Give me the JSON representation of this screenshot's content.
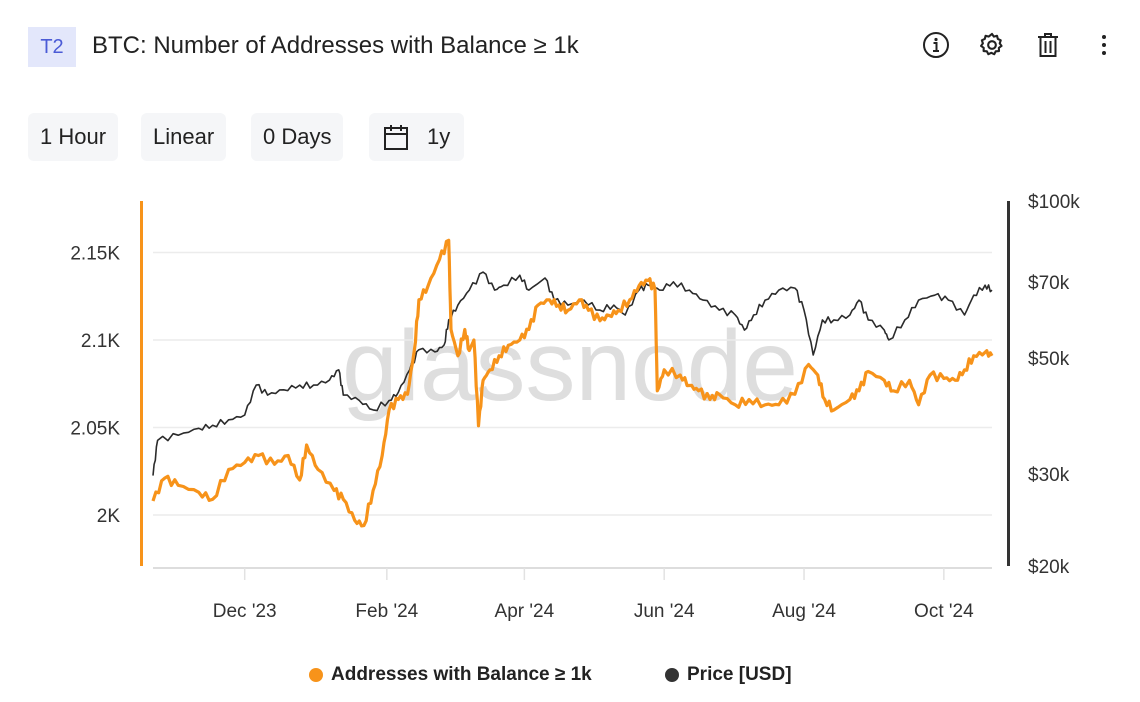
{
  "header": {
    "badge": "T2",
    "title": "BTC: Number of Addresses with Balance ≥ 1k",
    "icons": [
      "info-icon",
      "gear-icon",
      "trash-icon",
      "more-vertical-icon"
    ]
  },
  "controls": {
    "resolution": "1 Hour",
    "scale": "Linear",
    "smoothing": "0 Days",
    "range": "1y",
    "range_icon": "calendar-icon"
  },
  "chart_data": {
    "type": "line",
    "watermark": "glassnode",
    "colors": {
      "addresses": "#f7931a",
      "price": "#2b2b2b"
    },
    "x_ticks": [
      "Dec '23",
      "Feb '24",
      "Apr '24",
      "Jun '24",
      "Aug '24",
      "Oct '24"
    ],
    "x_tick_dates": [
      "2023-12-01",
      "2024-02-01",
      "2024-04-01",
      "2024-06-01",
      "2024-08-01",
      "2024-10-01"
    ],
    "xlim": [
      "2023-10-22",
      "2024-10-22"
    ],
    "y_left": {
      "ticks": [
        "2K",
        "2.05K",
        "2.1K",
        "2.15K"
      ],
      "tick_values": [
        2000,
        2050,
        2100,
        2150
      ],
      "range": [
        1970,
        2180
      ],
      "scale": "linear"
    },
    "y_right": {
      "ticks": [
        "$20k",
        "$30k",
        "$50k",
        "$70k",
        "$100k"
      ],
      "tick_values": [
        20000,
        30000,
        50000,
        70000,
        100000
      ],
      "range": [
        20000,
        100000
      ],
      "scale": "log"
    },
    "grid": true,
    "legend_position": "bottom",
    "series": [
      {
        "name": "Addresses with Balance ≥ 1k",
        "axis": "left",
        "x": [
          "2023-10-22",
          "2023-10-27",
          "2023-11-02",
          "2023-11-11",
          "2023-11-17",
          "2023-11-24",
          "2023-12-01",
          "2023-12-07",
          "2023-12-14",
          "2023-12-20",
          "2023-12-25",
          "2023-12-28",
          "2024-01-02",
          "2024-01-09",
          "2024-01-13",
          "2024-01-18",
          "2024-01-22",
          "2024-01-26",
          "2024-01-30",
          "2024-02-02",
          "2024-02-06",
          "2024-02-10",
          "2024-02-13",
          "2024-02-15",
          "2024-02-19",
          "2024-02-24",
          "2024-02-28",
          "2024-02-29",
          "2024-03-03",
          "2024-03-06",
          "2024-03-08",
          "2024-03-10",
          "2024-03-12",
          "2024-03-14",
          "2024-03-17",
          "2024-03-21",
          "2024-03-25",
          "2024-03-30",
          "2024-04-03",
          "2024-04-07",
          "2024-04-12",
          "2024-04-16",
          "2024-04-20",
          "2024-04-25",
          "2024-04-29",
          "2024-05-04",
          "2024-05-08",
          "2024-05-12",
          "2024-05-17",
          "2024-05-21",
          "2024-05-25",
          "2024-05-28",
          "2024-05-29",
          "2024-06-01",
          "2024-06-08",
          "2024-06-12",
          "2024-06-16",
          "2024-06-21",
          "2024-06-25",
          "2024-07-02",
          "2024-07-08",
          "2024-07-15",
          "2024-07-21",
          "2024-07-28",
          "2024-08-03",
          "2024-08-07",
          "2024-08-10",
          "2024-08-14",
          "2024-08-21",
          "2024-08-25",
          "2024-08-29",
          "2024-09-05",
          "2024-09-09",
          "2024-09-16",
          "2024-09-20",
          "2024-09-25",
          "2024-10-01",
          "2024-10-06",
          "2024-10-10",
          "2024-10-14",
          "2024-10-19",
          "2024-10-22"
        ],
        "values": [
          2008,
          2021,
          2017,
          2013,
          2009,
          2026,
          2030,
          2034,
          2029,
          2034,
          2020,
          2040,
          2026,
          2014,
          2009,
          1997,
          1994,
          2014,
          2034,
          2060,
          2066,
          2069,
          2094,
          2123,
          2131,
          2146,
          2157,
          2106,
          2091,
          2106,
          2094,
          2100,
          2051,
          2077,
          2083,
          2091,
          2097,
          2100,
          2106,
          2120,
          2123,
          2120,
          2117,
          2123,
          2117,
          2111,
          2114,
          2117,
          2123,
          2131,
          2134,
          2129,
          2071,
          2083,
          2080,
          2074,
          2071,
          2066,
          2069,
          2063,
          2066,
          2063,
          2063,
          2069,
          2086,
          2080,
          2066,
          2060,
          2066,
          2071,
          2082,
          2077,
          2071,
          2077,
          2063,
          2080,
          2078,
          2077,
          2083,
          2091,
          2093,
          2091
        ]
      },
      {
        "name": "Price [USD]",
        "axis": "right",
        "x": [
          "2023-10-22",
          "2023-10-24",
          "2023-11-02",
          "2023-11-11",
          "2023-11-17",
          "2023-11-24",
          "2023-12-01",
          "2023-12-06",
          "2023-12-11",
          "2023-12-18",
          "2023-12-25",
          "2023-12-31",
          "2024-01-07",
          "2024-01-11",
          "2024-01-13",
          "2024-01-20",
          "2024-01-26",
          "2024-02-02",
          "2024-02-06",
          "2024-02-11",
          "2024-02-15",
          "2024-02-22",
          "2024-02-26",
          "2024-02-28",
          "2024-03-03",
          "2024-03-08",
          "2024-03-14",
          "2024-03-19",
          "2024-03-23",
          "2024-03-30",
          "2024-04-03",
          "2024-04-10",
          "2024-04-14",
          "2024-04-20",
          "2024-04-27",
          "2024-05-04",
          "2024-05-10",
          "2024-05-15",
          "2024-05-21",
          "2024-05-25",
          "2024-05-30",
          "2024-06-05",
          "2024-06-12",
          "2024-06-18",
          "2024-06-25",
          "2024-07-02",
          "2024-07-06",
          "2024-07-10",
          "2024-07-15",
          "2024-07-21",
          "2024-07-28",
          "2024-08-01",
          "2024-08-05",
          "2024-08-09",
          "2024-08-14",
          "2024-08-21",
          "2024-08-25",
          "2024-08-29",
          "2024-09-05",
          "2024-09-07",
          "2024-09-14",
          "2024-09-20",
          "2024-09-27",
          "2024-10-03",
          "2024-10-10",
          "2024-10-14",
          "2024-10-19",
          "2024-10-22"
        ],
        "values": [
          29800,
          34800,
          35600,
          36700,
          37200,
          38100,
          38900,
          44400,
          42500,
          43500,
          44400,
          44400,
          45400,
          47500,
          42500,
          41500,
          39800,
          41500,
          43000,
          47500,
          51900,
          51400,
          53000,
          59200,
          63200,
          67500,
          73100,
          67500,
          69000,
          72100,
          67500,
          71200,
          64600,
          63200,
          64600,
          61800,
          63200,
          60500,
          67500,
          69000,
          67500,
          70000,
          67500,
          64600,
          61800,
          60500,
          56600,
          60500,
          64600,
          67500,
          68100,
          61800,
          50700,
          59200,
          59200,
          60500,
          64600,
          59200,
          56600,
          54200,
          59200,
          64600,
          66000,
          64600,
          60500,
          66000,
          69000,
          67500
        ]
      }
    ]
  }
}
